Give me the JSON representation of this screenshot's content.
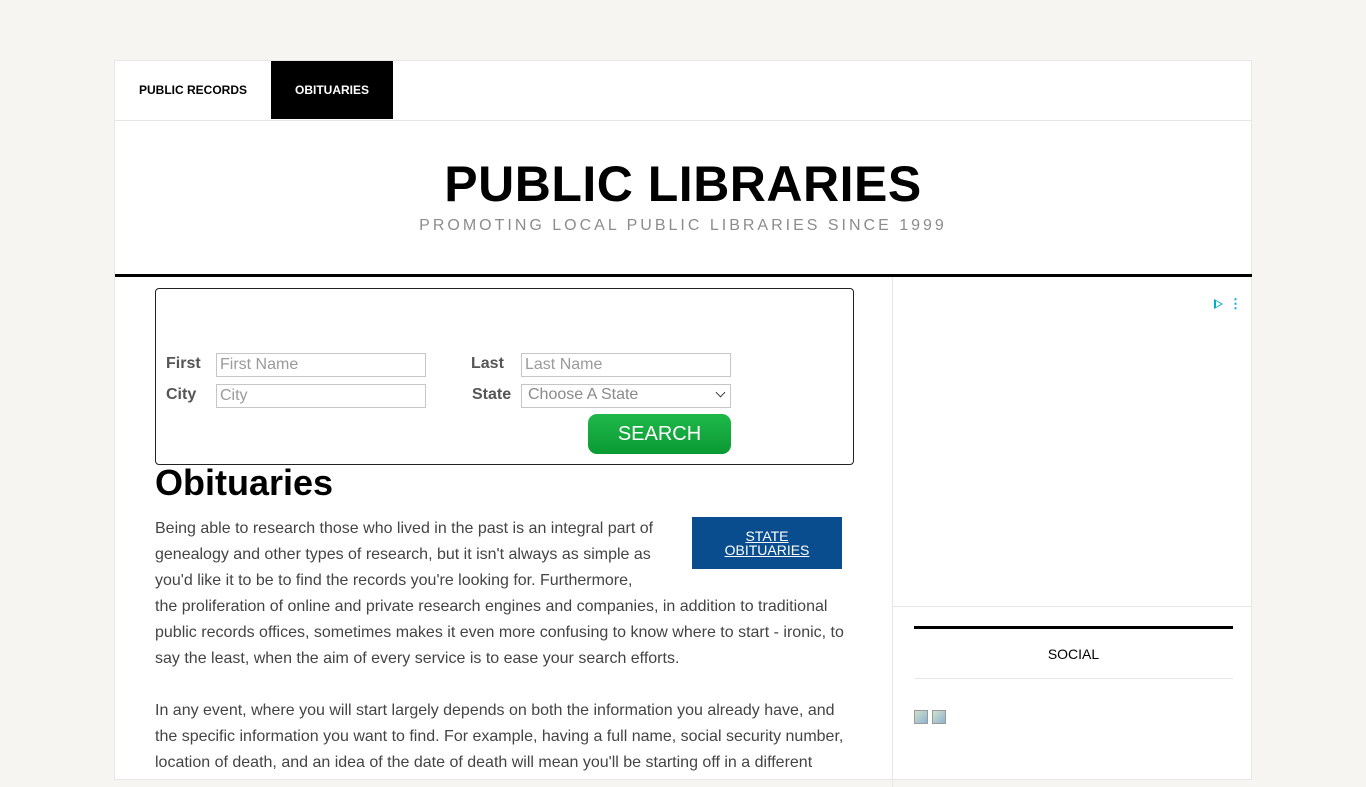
{
  "nav": {
    "items": [
      {
        "label": "PUBLIC RECORDS"
      },
      {
        "label": "OBITUARIES"
      }
    ]
  },
  "header": {
    "title": "PUBLIC LIBRARIES",
    "tagline": "PROMOTING LOCAL PUBLIC LIBRARIES SINCE 1999"
  },
  "search_form": {
    "first_label": "First",
    "first_placeholder": "First Name",
    "last_label": "Last",
    "last_placeholder": "Last Name",
    "city_label": "City",
    "city_placeholder": "City",
    "state_label": "State",
    "state_selected": "Choose A State",
    "search_label": "SEARCH"
  },
  "main": {
    "title": "Obituaries",
    "state_button": "STATE\nOBITUARIES",
    "paragraph1": "Being able to research those who lived in the past is an integral part of genealogy and other types of research, but it isn't always as simple as you'd like it to be to find the records you're looking for. Furthermore, the proliferation of online and private research engines and companies, in addition to traditional public records offices, sometimes makes it even more confusing to know where to start - ironic, to say the least, when the aim of every service is to ease your search efforts.",
    "paragraph2": "In any event, where you will start largely depends on both the information you already have, and the specific information you want to find. For example, having a full name, social security number, location of death, and an idea of the date of death will mean you'll be starting off in a different"
  },
  "sidebar": {
    "social_title": "SOCIAL"
  },
  "colors": {
    "nav_active_bg": "#000000",
    "search_button": "#12a83e",
    "state_button_bg": "#0a4d8f"
  }
}
